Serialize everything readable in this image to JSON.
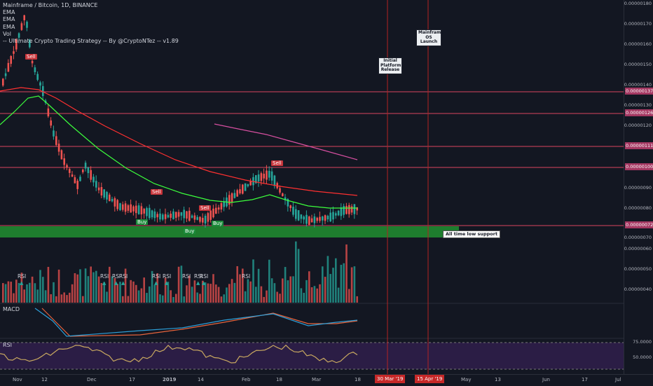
{
  "legend": {
    "title": "Mainframe / Bitcoin, 1D, BINANCE",
    "lines": [
      "EMA",
      "EMA",
      "EMA",
      "Vol",
      "-- Ultimate Crypto Trading Strategy -- By @CryptoNTez -- v1.89"
    ]
  },
  "signals": {
    "sell": [
      "Sell",
      "Sell",
      "Sell",
      "Sell"
    ],
    "buy": [
      "Buy",
      "Buy",
      "Buy"
    ],
    "rsi": [
      "RSI",
      "RSI",
      "RSI",
      "RSI",
      "RSI",
      "RSI",
      "RSI",
      "RSI",
      "RSI",
      "RSI"
    ]
  },
  "annotations": {
    "initial": "Initial Platform Release",
    "mainframe": "Mainframe OS Launch",
    "support": "All time low support"
  },
  "panes": {
    "macd": "MACD",
    "rsi": "RSI"
  },
  "price_axis": {
    "labels": [
      "0.00000180",
      "0.00000170",
      "0.00000160",
      "0.00000150",
      "0.00000140",
      "0.00000130",
      "0.00000120",
      "0.00000090",
      "0.00000080",
      "0.00000070",
      "0.00000060",
      "0.00000050",
      "0.00000040"
    ],
    "highlighted": [
      "0.00000137",
      "0.00000126",
      "0.00000111",
      "0.00000100",
      "0.00000072"
    ]
  },
  "rsi_axis": {
    "labels": [
      "75.0000",
      "50.0000"
    ]
  },
  "time_axis": {
    "labels": [
      "Nov",
      "12",
      "Dec",
      "17",
      "2019",
      "14",
      "Feb",
      "18",
      "Mar",
      "18",
      "May",
      "13",
      "Jun",
      "17",
      "Jul"
    ],
    "highlighted": [
      "30 Mar '19",
      "15 Apr '19"
    ]
  },
  "colors": {
    "background": "#131722",
    "up": "#26a69a",
    "down": "#ef5350",
    "ema_fast": "#ff3030",
    "ema_slow": "#3cff3c",
    "ema_pink": "#d64fa0",
    "support_zone": "#1e7d2e",
    "level_line": "#d9465f"
  }
}
